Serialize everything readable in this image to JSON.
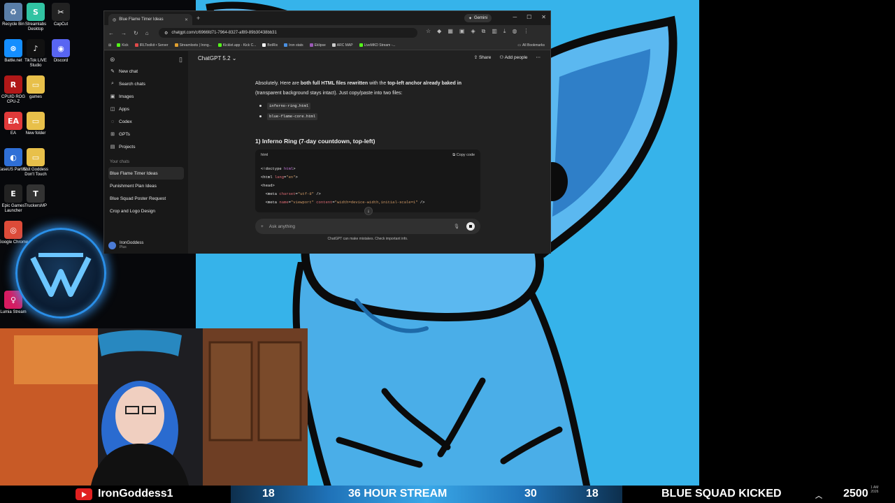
{
  "desktop": {
    "icons": [
      {
        "label": "Recycle Bin",
        "color": "#5a7ea8",
        "glyph": "♻"
      },
      {
        "label": "Streamlabs Desktop",
        "color": "#31c3a2",
        "glyph": "S"
      },
      {
        "label": "CapCut",
        "color": "#222222",
        "glyph": "✂"
      },
      {
        "label": "Battle.net",
        "color": "#148eff",
        "glyph": "⊛"
      },
      {
        "label": "TikTok LIVE Studio",
        "color": "#111111",
        "glyph": "♪"
      },
      {
        "label": "Discord",
        "color": "#5865f2",
        "glyph": "◉"
      },
      {
        "label": "CPUID ROG CPU-Z",
        "color": "#b01818",
        "glyph": "R"
      },
      {
        "label": "games",
        "color": "#e8c04a",
        "glyph": "▭"
      },
      {
        "label": "EA",
        "color": "#e03a3a",
        "glyph": "EA"
      },
      {
        "label": "New folder",
        "color": "#e8c04a",
        "glyph": "▭"
      },
      {
        "label": "EaseUS Partiti...",
        "color": "#2f6fd6",
        "glyph": "◐"
      },
      {
        "label": "Shit Goddess Don't Touch",
        "color": "#e8c04a",
        "glyph": "▭"
      },
      {
        "label": "Epic Games Launcher",
        "color": "#222222",
        "glyph": "E"
      },
      {
        "label": "TruckersMP",
        "color": "#333333",
        "glyph": "T"
      },
      {
        "label": "Google Chrome",
        "color": "#dd4b39",
        "glyph": "◎"
      },
      {
        "label": "Lumia Stream",
        "color": "#d81b60",
        "glyph": "♀"
      }
    ]
  },
  "browser": {
    "tab_title": "Blue Flame Timer Ideas",
    "gemini_label": "Gemini",
    "url": "chatgpt.com/c/6966fd71-7964-8327-af89-89b30438bb31",
    "bookmarks": [
      {
        "label": "Kick",
        "color": "#53fc18"
      },
      {
        "label": "IRLToolkit • Server",
        "color": "#e04a4a"
      },
      {
        "label": "Streamloots | Irong...",
        "color": "#e0a030"
      },
      {
        "label": "Kicklet.app - Kick C...",
        "color": "#53fc18"
      },
      {
        "label": "BotRix",
        "color": "#ffffff"
      },
      {
        "label": "Iron stats",
        "color": "#4a90e2"
      },
      {
        "label": "Eklipse",
        "color": "#9b59b6"
      },
      {
        "label": "ARC MAP",
        "color": "#cccccc"
      },
      {
        "label": "LiveMKD Stream -...",
        "color": "#53fc18"
      }
    ],
    "all_bookmarks": "All Bookmarks"
  },
  "chatgpt": {
    "model": "ChatGPT 5.2",
    "share": "Share",
    "add_people": "Add people",
    "sidebar": {
      "items": [
        {
          "label": "New chat",
          "icon": "✎"
        },
        {
          "label": "Search chats",
          "icon": "⌕"
        },
        {
          "label": "Images",
          "icon": "▣"
        },
        {
          "label": "Apps",
          "icon": "◫"
        },
        {
          "label": "Codex",
          "icon": "◌"
        },
        {
          "label": "GPTs",
          "icon": "⊞"
        },
        {
          "label": "Projects",
          "icon": "▤"
        }
      ],
      "section": "Your chats",
      "chats": [
        "Blue Flame Timer Ideas",
        "Punishment Plan Ideas",
        "Blue Squad Poster Request",
        "Crop and Logo Design"
      ],
      "profile_name": "IronGoddess",
      "profile_plan": "Plus"
    },
    "message": {
      "p1_a": "Absolutely. Here are ",
      "p1_b": "both full HTML files rewritten",
      "p1_c": " with the ",
      "p1_d": "top-left anchor already baked in",
      "p1_e": " (transparent background stays intact). Just copy/paste into two files:",
      "files": [
        "inferno-ring.html",
        "blue-flame-core.html"
      ],
      "section_heading": "1) Inferno Ring (7-day countdown, top-left)"
    },
    "code": {
      "lang": "html",
      "copy": "Copy code",
      "l1_a": "<!doctype ",
      "l1_b": "html",
      "l1_c": ">",
      "l2_a": "<html ",
      "l2_b": "lang",
      "l2_c": "=",
      "l2_d": "\"en\"",
      "l2_e": ">",
      "l3": "<head>",
      "l4_a": "  <meta ",
      "l4_b": "charset",
      "l4_c": "=",
      "l4_d": "\"utf-8\"",
      "l4_e": " />",
      "l5_a": "  <meta ",
      "l5_b": "name",
      "l5_c": "=",
      "l5_d": "\"viewport\"",
      "l5_e": " ",
      "l5_f": "content",
      "l5_g": "=",
      "l5_h": "\"width=device-width,initial-scale=1\"",
      "l5_i": " />"
    },
    "composer_placeholder": "Ask anything",
    "disclaimer": "ChatGPT can make mistakes. Check important info."
  },
  "ticker": {
    "channel": "IronGoddess1",
    "num1": "18",
    "stream_title": "36 HOUR STREAM",
    "num2": "30",
    "num3": "18",
    "kicked": "BLUE SQUAD KICKED",
    "count": "2500",
    "time": "1 AM",
    "year": "2026"
  }
}
